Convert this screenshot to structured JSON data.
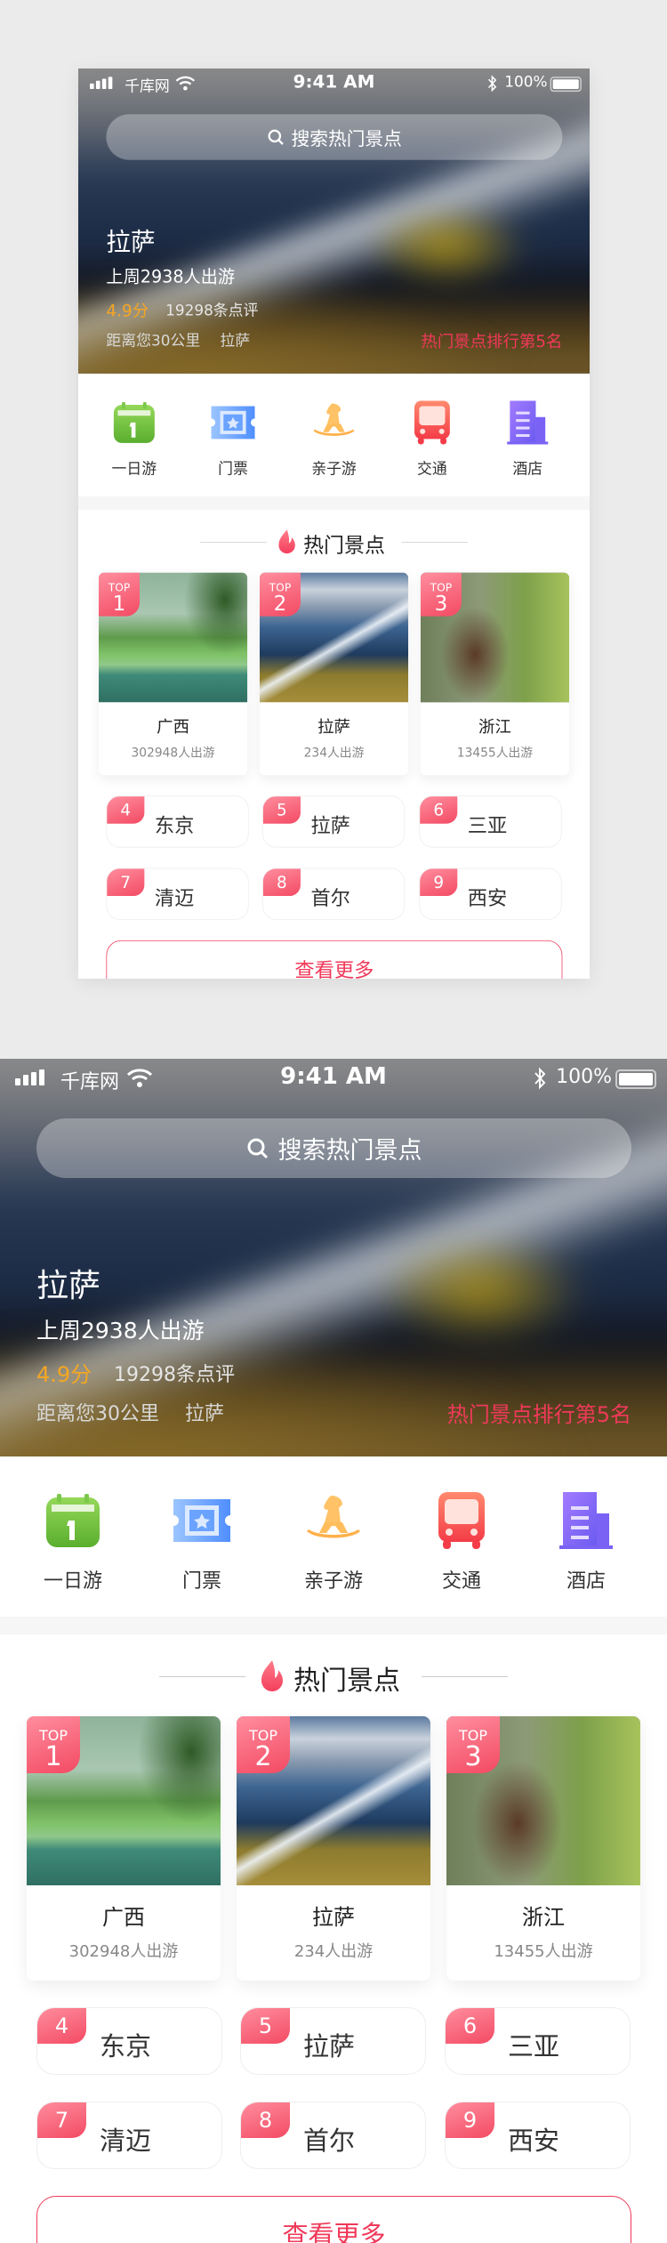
{
  "status_bar": {
    "carrier": "千库网",
    "time": "9:41 AM",
    "battery": "100%"
  },
  "search": {
    "placeholder": "搜索热门景点",
    "icon": "search-icon"
  },
  "hero": {
    "title": "拉萨",
    "trips": "上周2938人出游",
    "rating": "4.9分",
    "reviews": "19298条点评",
    "distance": "距离您30公里",
    "city": "拉萨",
    "rank": "热门景点排行第5名"
  },
  "categories": [
    {
      "label": "一日游",
      "icon": "calendar-icon",
      "color": "#6cc23a"
    },
    {
      "label": "门票",
      "icon": "ticket-icon",
      "color": "#5b9cff"
    },
    {
      "label": "亲子游",
      "icon": "rocking-horse-icon",
      "color": "#ffb34a"
    },
    {
      "label": "交通",
      "icon": "bus-icon",
      "color": "#f5554f"
    },
    {
      "label": "酒店",
      "icon": "hotel-icon",
      "color": "#8266f5"
    }
  ],
  "hot": {
    "heading": "热门景点",
    "icon": "flame-icon"
  },
  "top_cards": [
    {
      "badge": "TOP",
      "rank": "1",
      "name": "广西",
      "count": "302948人出游"
    },
    {
      "badge": "TOP",
      "rank": "2",
      "name": "拉萨",
      "count": "234人出游"
    },
    {
      "badge": "TOP",
      "rank": "3",
      "name": "浙江",
      "count": "13455人出游"
    }
  ],
  "ranked": [
    {
      "rank": "4",
      "name": "东京"
    },
    {
      "rank": "5",
      "name": "拉萨"
    },
    {
      "rank": "6",
      "name": "三亚"
    },
    {
      "rank": "7",
      "name": "清迈"
    },
    {
      "rank": "8",
      "name": "首尔"
    },
    {
      "rank": "9",
      "name": "西安"
    }
  ],
  "more_label": "查看更多",
  "colors": {
    "accent": "#f0395a",
    "rating": "#f5a623",
    "background": "#ebebeb"
  }
}
